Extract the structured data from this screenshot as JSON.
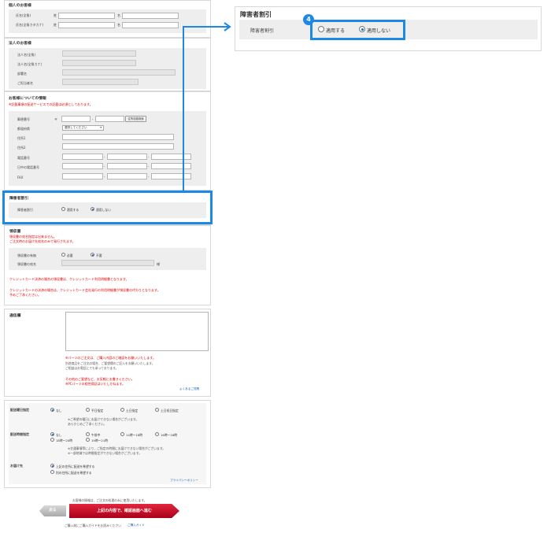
{
  "personal": {
    "title": "個人のお客様",
    "name_label": "氏名(全角)",
    "kana_label": "氏名(全角カタカナ)",
    "sei": "姓",
    "mei": "名"
  },
  "corporate": {
    "title": "法人のお客様",
    "company_label": "法人名(全角)",
    "company_kana_label": "法人名(全角カナ)",
    "dept_label": "部署名",
    "person_label": "ご担当者名"
  },
  "address": {
    "title": "お客様についての情報",
    "notice": "※記載事項の配送サービスでの記載は必須としております。",
    "postal_label": "郵便番号",
    "postal_mark": "〒",
    "postal_dash": "-",
    "postal_search": "住所自動検索",
    "pref_label": "都道府県",
    "pref_select": "選択してください",
    "addr1_label": "住所1",
    "addr2_label": "住所2",
    "tel_label": "電話番号",
    "daytime_label": "日中の電話番号",
    "fax_label": "FAX",
    "dash": "-"
  },
  "disability": {
    "title": "障害者割引",
    "field_label": "障害者割引",
    "opt_apply": "適用する",
    "opt_not_apply": "適用しない",
    "step": "4"
  },
  "receipt": {
    "title": "領収書",
    "notice1": "領収書の宛名指定は出来ません。",
    "notice2": "ご注文時のお届け先宛名のみで発行されます。",
    "need_label": "領収書の有無",
    "opt_need": "必要",
    "opt_no": "不要",
    "addressee_label": "領収書の宛名",
    "sama": "様",
    "credit_note1": "クレジットカード決済の場合の領収書は、クレジットカード利用明細書となります。",
    "credit_note2": "クレジットカードの決済の場合は、クレジットカード会社発行の利用明細書が領収書の代わりとなります。",
    "credit_note3": "予めご了承ください。"
  },
  "remarks": {
    "title": "通信欄",
    "note1": "※パーツのご注文は、ご購入内容のご確認をお願いいたします。",
    "note2": "別途商品をご注文の場合、ご要望欄のご記入をお願いいたします。",
    "note3": "ご相談はお電話にても承っております。",
    "note4": "その他のご要望など、お気軽にお書きください。",
    "note5": "※PCパーツの相性保証はいたしかねます。",
    "link": "よくあるご質問"
  },
  "delivery": {
    "date_label": "配送曜日指定",
    "date_opts": [
      "なし",
      "平日指定",
      "土日指定",
      "土日祝日指定"
    ],
    "date_note1": "※ご希望の曜日にお届けできない場合がございます。",
    "date_note2": "あらかじめご了承ください。",
    "time_label": "配送時間指定",
    "time_opts": [
      "なし",
      "午前中",
      "14時〜16時",
      "16時〜18時",
      "18時〜20時",
      "19時〜21時"
    ],
    "time_note1": "※交通事情等により、ご指定の時間にお届けできない場合がございます。",
    "time_note2": "※一部地域では時間指定ができない場合がございます。",
    "dest_label": "お届け先",
    "dest_opt1": "上記の住所に配送を希望する",
    "dest_opt2": "別の住所に配送を希望する",
    "dest_link": "プライバシーポリシー"
  },
  "footer": {
    "note_top": "お客様の情報は、ご注文の処理のみに使用いたします。",
    "back": "戻る",
    "confirm": "上記の内容で、確認画面へ進む",
    "note_bottom": "ご購入前にご購入ガイドをお読みください",
    "guide_link": "ご購入ガイド"
  },
  "colors": {
    "highlight": "#1e88e5",
    "confirm": "#c8102e"
  }
}
